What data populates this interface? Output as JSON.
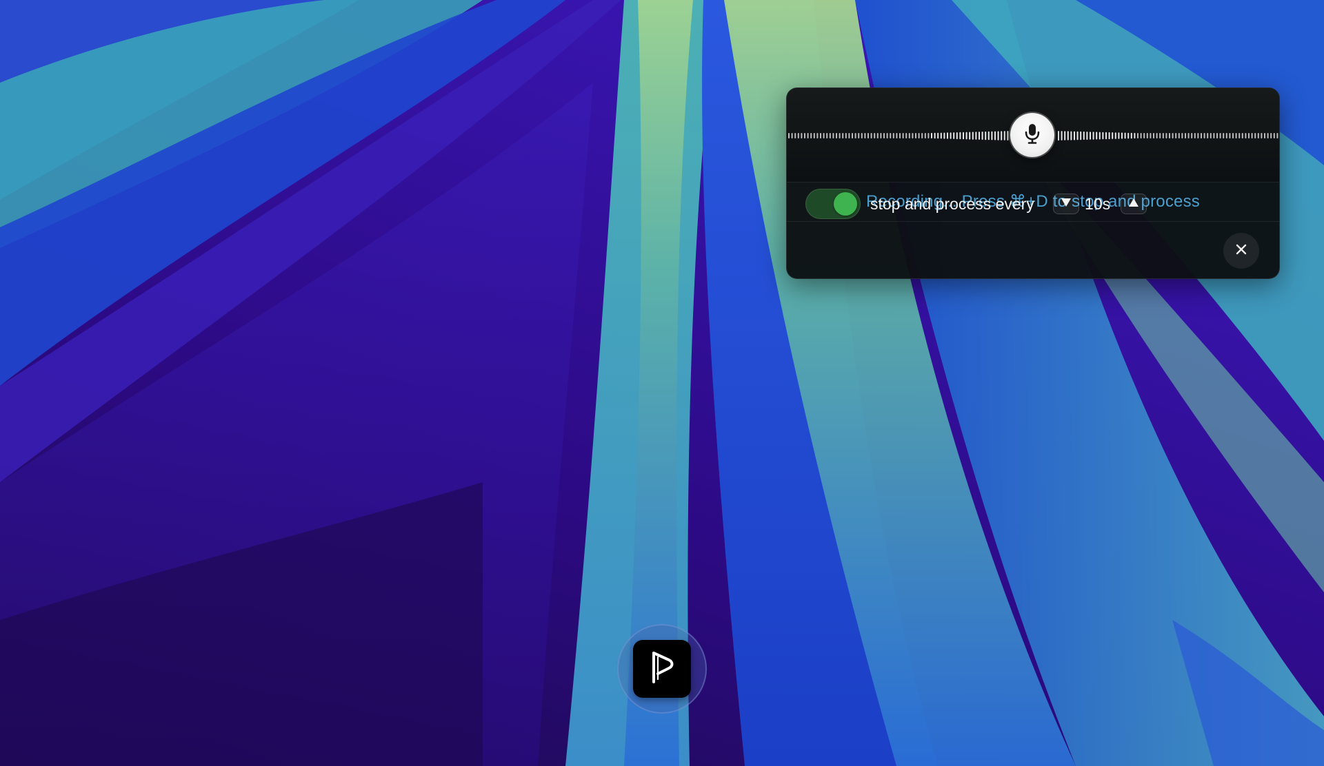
{
  "desktop": {
    "wallpaper_colors": {
      "deep_purple": "#2a0a78",
      "violet": "#3512a8",
      "blue": "#1a47d6",
      "teal": "#3fa9b8",
      "mint": "#8fcf9a",
      "pale_green": "#a6d690"
    }
  },
  "recorder": {
    "mic_icon": "microphone-icon",
    "status_text": "Recording... Press ⌘+D to stop and process",
    "auto_process": {
      "enabled": true,
      "label": "stop and process every",
      "interval_value": "10s",
      "decrease_icon": "triangle-down-icon",
      "increase_icon": "triangle-up-icon"
    },
    "close_icon": "close-icon",
    "colors": {
      "status_text": "#4b9fcf",
      "toggle_on": "#3fb34f",
      "panel_bg": "#0c1012"
    }
  },
  "dock": {
    "app_icon": "app-logo-icon"
  }
}
